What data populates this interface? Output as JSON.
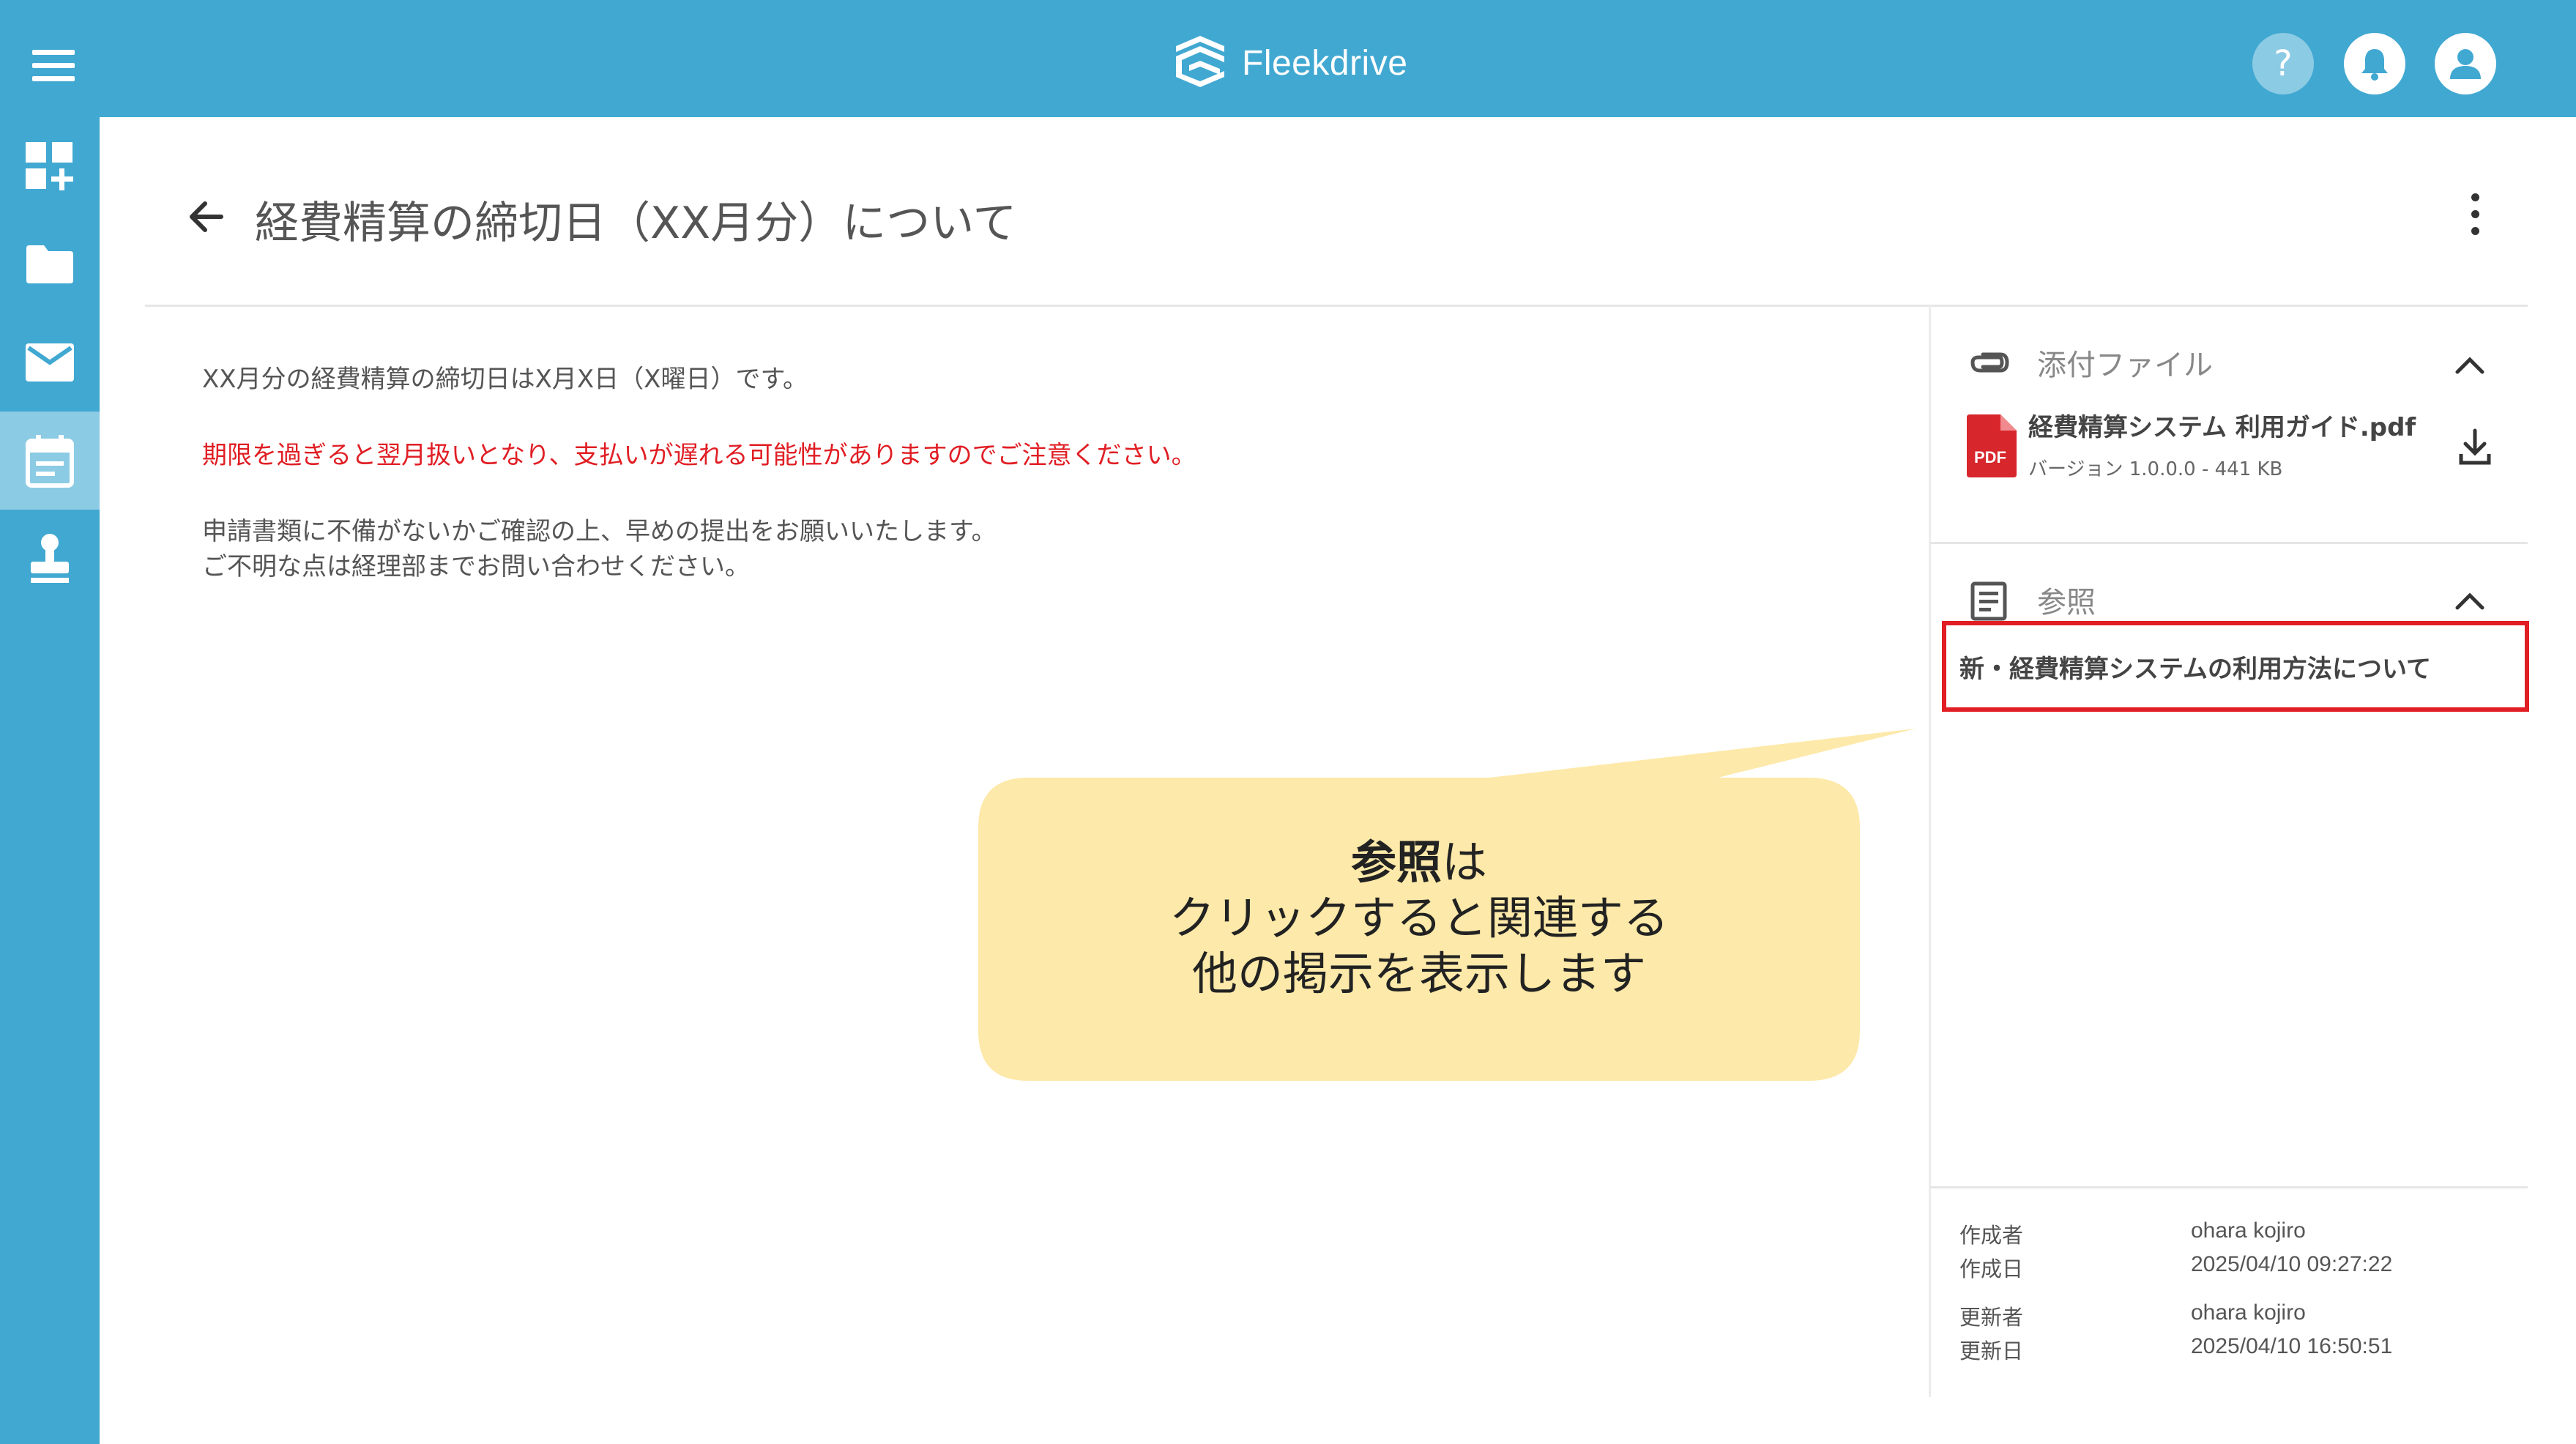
{
  "app": {
    "logo_text": "Fleekdrive",
    "brand_color": "#41a8d1",
    "accent_light": "#8ccbe4"
  },
  "header": {
    "icons": [
      "menu-icon",
      "help-icon",
      "bell-icon",
      "user-icon"
    ],
    "help_glyph": "?"
  },
  "sidebar": {
    "items": [
      {
        "icon": "dashboard-add-icon",
        "active": false
      },
      {
        "icon": "folder-icon",
        "active": false
      },
      {
        "icon": "mail-icon",
        "active": false
      },
      {
        "icon": "calendar-icon",
        "active": true
      },
      {
        "icon": "stamp-icon",
        "active": false
      }
    ]
  },
  "page": {
    "title": "経費精算の締切日（XX月分）について",
    "body": {
      "line1": "XX月分の経費精算の締切日はX月X日（X曜日）です。",
      "warning": "期限を過ぎると翌月扱いとなり、支払いが遅れる可能性がありますのでご注意ください。",
      "line3": "申請書類に不備がないかご確認の上、早めの提出をお願いいたします。",
      "line4": "ご不明な点は経理部までお問い合わせください。",
      "warning_color": "#e01e24"
    }
  },
  "panel": {
    "attachments": {
      "title": "添付ファイル",
      "file_name": "経費精算システム 利用ガイド.pdf",
      "file_meta": "バージョン 1.0.0.0 - 441 KB",
      "file_icon_label": "PDF"
    },
    "references": {
      "title": "参照",
      "link": "新・経費精算システムの利用方法について"
    },
    "meta": {
      "created_by_label": "作成者",
      "created_by": "ohara kojiro",
      "created_at_label": "作成日",
      "created_at": "2025/04/10 09:27:22",
      "updated_by_label": "更新者",
      "updated_by": "ohara kojiro",
      "updated_at_label": "更新日",
      "updated_at": "2025/04/10 16:50:51"
    }
  },
  "callout": {
    "bold": "参照",
    "suffix": "は",
    "line2": "クリックすると関連する",
    "line3": "他の掲示を表示します",
    "fill": "#fde9a9"
  }
}
